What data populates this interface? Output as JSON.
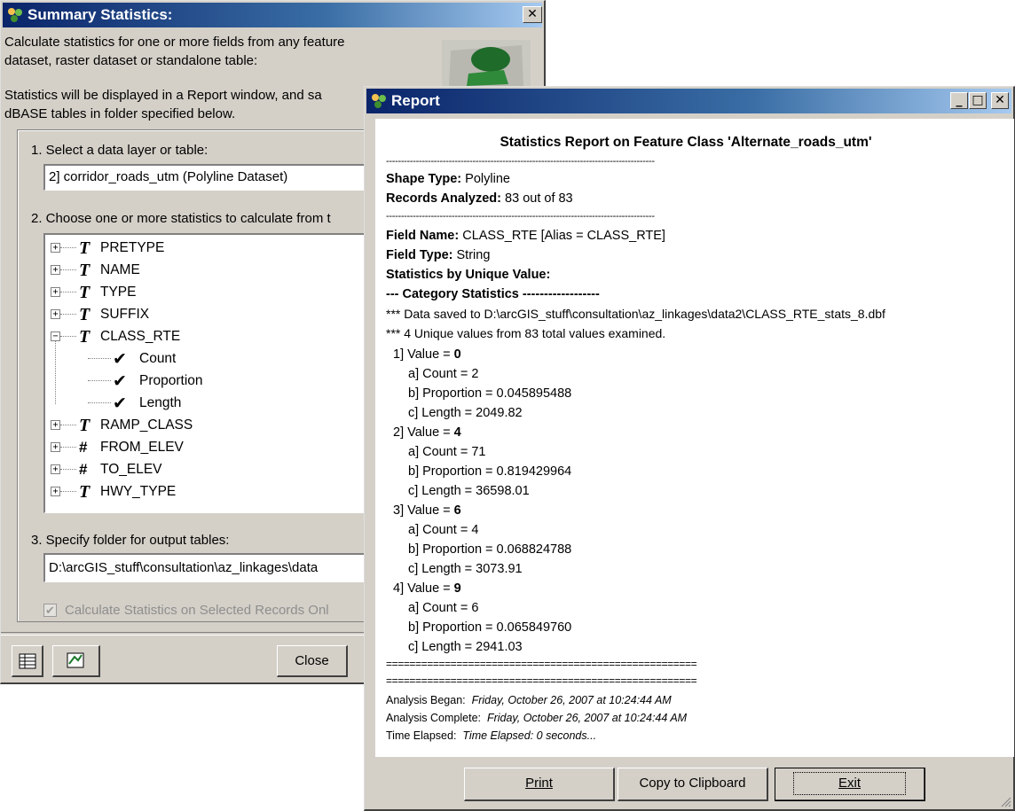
{
  "summary_dialog": {
    "title": "Summary Statistics:",
    "intro_line1": "Calculate statistics for one or more fields from any feature",
    "intro_line2": "dataset, raster dataset or standalone table:",
    "intro_line3": "Statistics will be displayed in a Report window, and sa",
    "intro_line4": "dBASE tables in folder specified below.",
    "step1_label": "1.  Select a data layer or table:",
    "layer_value": "2] corridor_roads_utm  (Polyline Dataset)",
    "step2_label": "2.  Choose one or more statistics to calculate from t",
    "fields": [
      {
        "icon": "T",
        "name": "PRETYPE",
        "expand": "+"
      },
      {
        "icon": "T",
        "name": "NAME",
        "expand": "+"
      },
      {
        "icon": "T",
        "name": "TYPE",
        "expand": "+"
      },
      {
        "icon": "T",
        "name": "SUFFIX",
        "expand": "+"
      },
      {
        "icon": "T",
        "name": "CLASS_RTE",
        "expand": "−"
      },
      {
        "child": true,
        "name": "Count"
      },
      {
        "child": true,
        "name": "Proportion"
      },
      {
        "child": true,
        "name": "Length"
      },
      {
        "icon": "T",
        "name": "RAMP_CLASS",
        "expand": "+"
      },
      {
        "icon": "#",
        "name": "FROM_ELEV",
        "expand": "+"
      },
      {
        "icon": "#",
        "name": "TO_ELEV",
        "expand": "+"
      },
      {
        "icon": "T",
        "name": "HWY_TYPE",
        "expand": "+"
      }
    ],
    "step3_label": "3.  Specify folder for output tables:",
    "folder_value": "D:\\arcGIS_stuff\\consultation\\az_linkages\\data",
    "selected_only_label": "Calculate Statistics on Selected Records Onl",
    "close_label": "Close"
  },
  "report": {
    "title": "Report",
    "heading": "Statistics Report on Feature Class 'Alternate_roads_utm'",
    "separator": "------------------------------------------------------------------------------------------",
    "shape_type_label": "Shape Type:",
    "shape_type_value": "Polyline",
    "records_label": "Records Analyzed:",
    "records_value": "83 out of 83",
    "field_name_label": "Field Name:",
    "field_name_value": "CLASS_RTE  [Alias = CLASS_RTE]",
    "field_type_label": "Field Type:",
    "field_type_value": "String",
    "stats_by_unique": "Statistics by Unique Value:",
    "category_stats": "--- Category Statistics ------------------",
    "saved_line": "*** Data saved to D:\\arcGIS_stuff\\consultation\\az_linkages\\data2\\CLASS_RTE_stats_8.dbf",
    "unique_line": "*** 4 Unique values from 83 total values examined.",
    "values": [
      {
        "label": "1] Value = ",
        "value": "0",
        "count": "a] Count = 2",
        "proportion": "b] Proportion = 0.045895488",
        "length": "c] Length = 2049.82"
      },
      {
        "label": "2] Value = ",
        "value": "4",
        "count": "a] Count = 71",
        "proportion": "b] Proportion = 0.819429964",
        "length": "c] Length = 36598.01"
      },
      {
        "label": "3] Value = ",
        "value": "6",
        "count": "a] Count = 4",
        "proportion": "b] Proportion = 0.068824788",
        "length": "c] Length = 3073.91"
      },
      {
        "label": "4] Value = ",
        "value": "9",
        "count": "a] Count = 6",
        "proportion": "b] Proportion = 0.065849760",
        "length": "c] Length = 2941.03"
      }
    ],
    "equals_line": "=====================================================",
    "began_label": "Analysis Began:",
    "began_value": "Friday, October 26, 2007 at 10:24:44 AM",
    "complete_label": "Analysis Complete:",
    "complete_value": "Friday, October 26, 2007 at 10:24:44 AM",
    "elapsed_label": "Time Elapsed:",
    "elapsed_value": "Time Elapsed: 0 seconds...",
    "print_label": "Print",
    "copy_label": "Copy to Clipboard",
    "exit_label": "Exit"
  }
}
